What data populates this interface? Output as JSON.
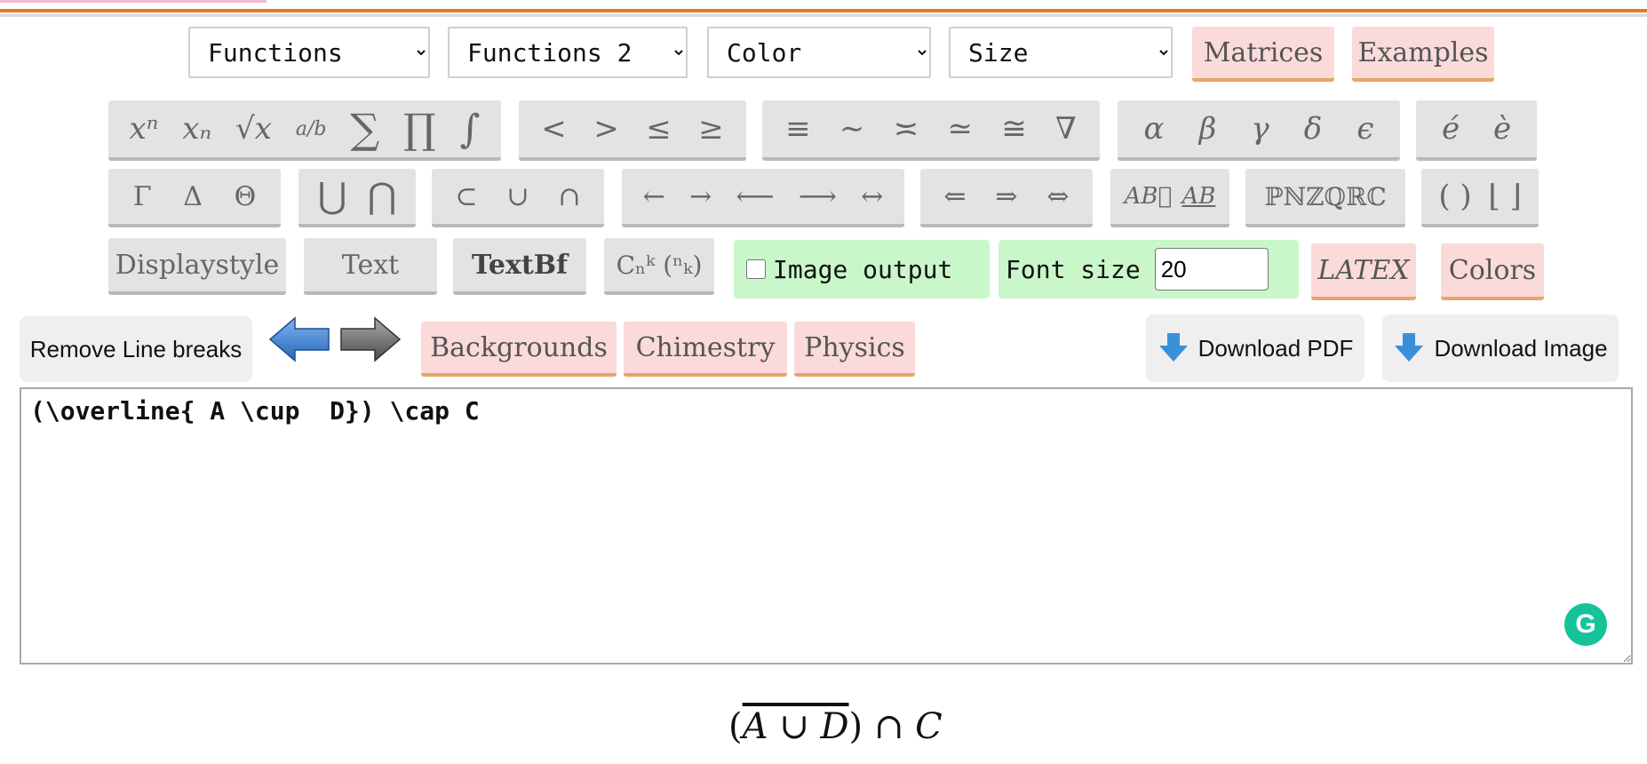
{
  "dropdowns": [
    {
      "selected": "Functions"
    },
    {
      "selected": "Functions 2"
    },
    {
      "selected": "Color"
    },
    {
      "selected": "Size"
    }
  ],
  "top_buttons": {
    "matrices": "Matrices",
    "examples": "Examples"
  },
  "row1": {
    "g1": [
      "xⁿ",
      "xₙ",
      "√x",
      "a/b",
      "∑",
      "∏",
      "∫"
    ],
    "g2": [
      "<",
      ">",
      "≤",
      "≥"
    ],
    "g3": [
      "≡",
      "∼",
      "≍",
      "≃",
      "≅",
      "∇"
    ],
    "g4": [
      "α",
      "β",
      "γ",
      "δ",
      "ϵ"
    ],
    "g5": [
      "é",
      "è"
    ]
  },
  "row2": {
    "g1": [
      "Γ",
      "Δ",
      "Θ"
    ],
    "g2": [
      "⋃",
      "⋂"
    ],
    "g3": [
      "⊂",
      "∪",
      "∩"
    ],
    "g4": [
      "←",
      "→",
      "⟵",
      "⟶",
      "↔"
    ],
    "g5": [
      "⇐",
      "⇒",
      "⇔"
    ],
    "g6": [
      "AB⃗",
      "AB"
    ],
    "g7": [
      "ℙℕℤℚℝℂ"
    ],
    "g8": [
      "( )",
      "⌊ ⌋"
    ]
  },
  "row3": {
    "displaystyle": "Displaystyle",
    "text": "Text",
    "textbf": "TextBf",
    "binom": "Cₙᵏ (ⁿₖ)",
    "image_output": "Image output",
    "font_size_label": "Font size",
    "font_size_value": "20",
    "latex": "LATEX",
    "colors": "Colors"
  },
  "row4": {
    "remove_line_breaks": "Remove Line breaks",
    "backgrounds": "Backgrounds",
    "chimestry": "Chimestry",
    "physics": "Physics",
    "download_pdf": "Download PDF",
    "download_image": "Download Image"
  },
  "editor": {
    "value": "(\\overline{ A \\cup  D}) \\cap C"
  },
  "output": {
    "open": "(",
    "over": "A ∪ D",
    "close": ")",
    "cap": " ∩ ",
    "c": "C"
  },
  "colors": {
    "accent_orange": "#e07b2a",
    "pink": "#fbdada",
    "green": "#c9f7c9",
    "blue_arrow": "#3f86d6",
    "grammarly": "#15c39a"
  }
}
